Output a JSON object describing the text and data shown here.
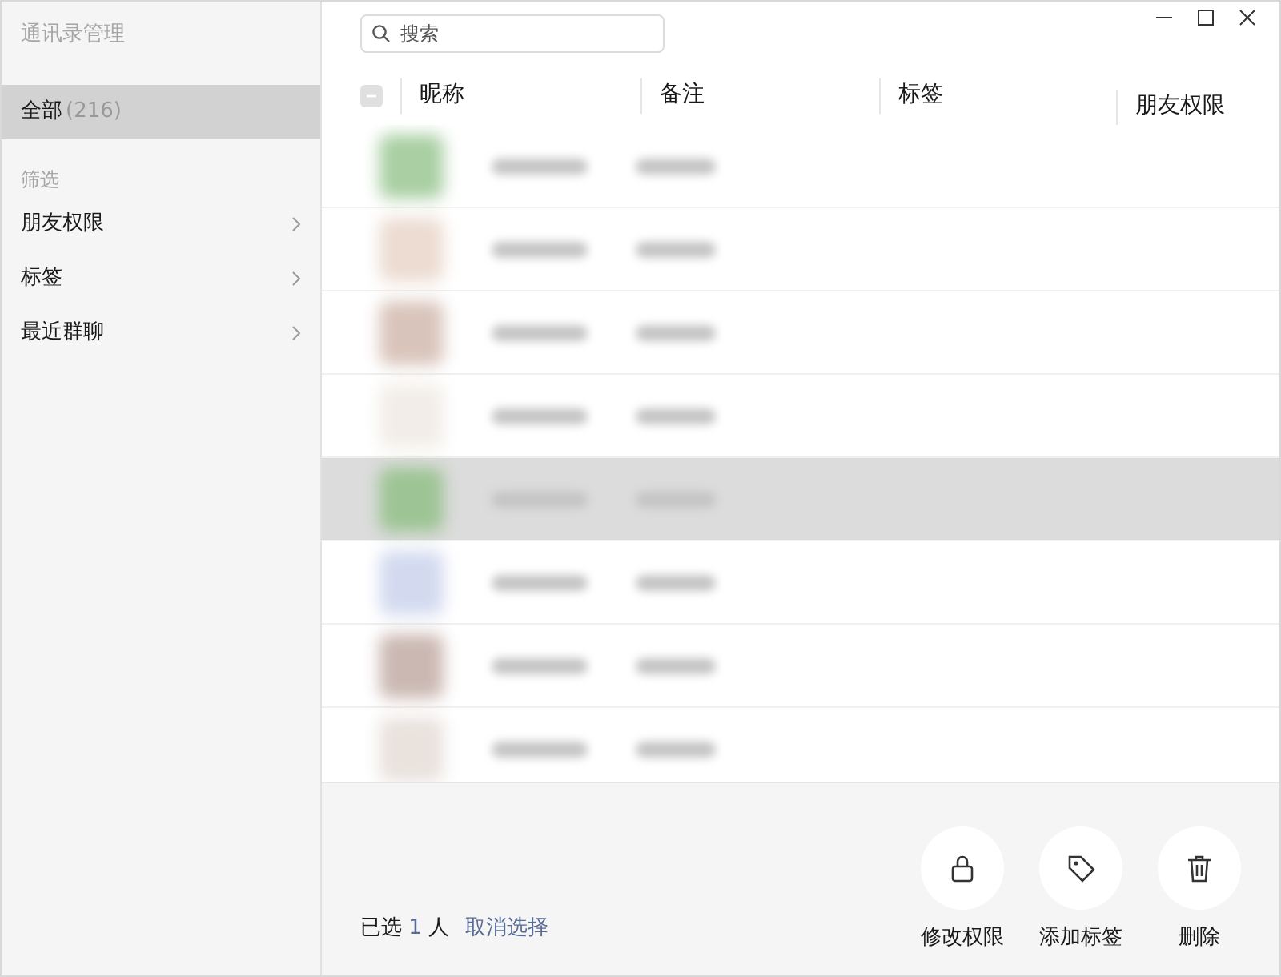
{
  "window": {
    "title": "通讯录管理"
  },
  "sidebar": {
    "items": [
      {
        "label": "全部",
        "count": "(216)",
        "selected": true
      }
    ],
    "section_label": "筛选",
    "filters": [
      {
        "label": "朋友权限"
      },
      {
        "label": "标签"
      },
      {
        "label": "最近群聊"
      }
    ]
  },
  "search": {
    "placeholder": "搜索"
  },
  "table": {
    "columns": [
      "昵称",
      "备注",
      "标签",
      "朋友权限"
    ],
    "rows": [
      {
        "selected": false
      },
      {
        "selected": false
      },
      {
        "selected": false
      },
      {
        "selected": false
      },
      {
        "selected": true
      },
      {
        "selected": false
      },
      {
        "selected": false
      },
      {
        "selected": false
      }
    ]
  },
  "footer": {
    "selected_prefix": "已选",
    "selected_count": "1",
    "selected_suffix": "人",
    "clear_link": "取消选择",
    "actions": [
      {
        "kind": "lock",
        "label": "修改权限"
      },
      {
        "kind": "tag",
        "label": "添加标签"
      },
      {
        "kind": "trash",
        "label": "删除"
      }
    ]
  }
}
